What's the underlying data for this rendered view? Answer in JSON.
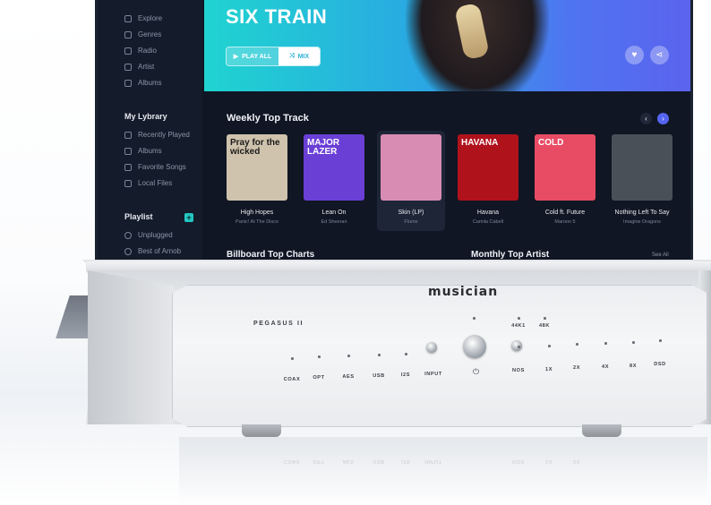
{
  "sidebar": {
    "nav": [
      {
        "label": "Explore",
        "icon": "explore-icon"
      },
      {
        "label": "Genres",
        "icon": "genres-icon"
      },
      {
        "label": "Radio",
        "icon": "radio-icon"
      },
      {
        "label": "Artist",
        "icon": "artist-icon"
      },
      {
        "label": "Albums",
        "icon": "albums-icon"
      }
    ],
    "library_heading": "My Lybrary",
    "library": [
      {
        "label": "Recently Played",
        "icon": "music-note-icon"
      },
      {
        "label": "Albums",
        "icon": "albums-icon"
      },
      {
        "label": "Favorite Songs",
        "icon": "heart-icon"
      },
      {
        "label": "Local Files",
        "icon": "folder-icon"
      }
    ],
    "playlist_heading": "Playlist",
    "add_playlist_symbol": "+",
    "playlists": [
      {
        "label": "Unplugged",
        "icon": "playlist-icon"
      },
      {
        "label": "Best of Arnob",
        "icon": "playlist-icon"
      }
    ]
  },
  "hero": {
    "title": "SIX TRAIN",
    "play_all_label": "PLAY ALL",
    "mix_label": "MIX",
    "like_icon": "heart-icon",
    "share_icon": "share-icon"
  },
  "weekly": {
    "title": "Weekly Top Track",
    "prev_symbol": "‹",
    "next_symbol": "›",
    "tracks": [
      {
        "title": "High Hopes",
        "artist": "Panic! At The Disco",
        "cover_text": "Pray for the wicked",
        "bg": "#cfc3ad",
        "fg": "#1c1c1c"
      },
      {
        "title": "Lean On",
        "artist": "Ed Sheeran",
        "cover_text": "MAJOR LAZER",
        "bg": "#6a3fd6",
        "fg": "#ffffff"
      },
      {
        "title": "Skin (LP)",
        "artist": "Flume",
        "cover_text": "",
        "bg": "#d98cb3",
        "fg": "#ffffff"
      },
      {
        "title": "Havana",
        "artist": "Camila Cabell",
        "cover_text": "HAVANA",
        "bg": "#b0121c",
        "fg": "#ffffff"
      },
      {
        "title": "Cold ft. Future",
        "artist": "Maroon 5",
        "cover_text": "COLD",
        "bg": "#e84c64",
        "fg": "#ffffff"
      },
      {
        "title": "Nothing Left To Say",
        "artist": "Imagine Dragons",
        "cover_text": "",
        "bg": "#4a5058",
        "fg": "#ffffff"
      }
    ]
  },
  "billboard_title": "Billboard Top Charts",
  "monthly_title": "Monthly Top Artist",
  "see_all": "See All",
  "device": {
    "brand": "musician",
    "model": "PEGASUS II",
    "labels": [
      "COAX",
      "OPT",
      "AES",
      "USB",
      "I2S",
      "INPUT",
      "NOS",
      "1X",
      "2X",
      "4X",
      "8X",
      "DSD"
    ],
    "rate_labels": [
      "44K1",
      "48K"
    ],
    "power_icon": "power-icon"
  },
  "colors": {
    "screen_bg": "#101623",
    "sidebar_bg": "#141b2a",
    "accent": "#22c7c0",
    "hero_start": "#1fd4d0",
    "hero_end": "#5b63ee",
    "nav_active": "#5564f0"
  }
}
